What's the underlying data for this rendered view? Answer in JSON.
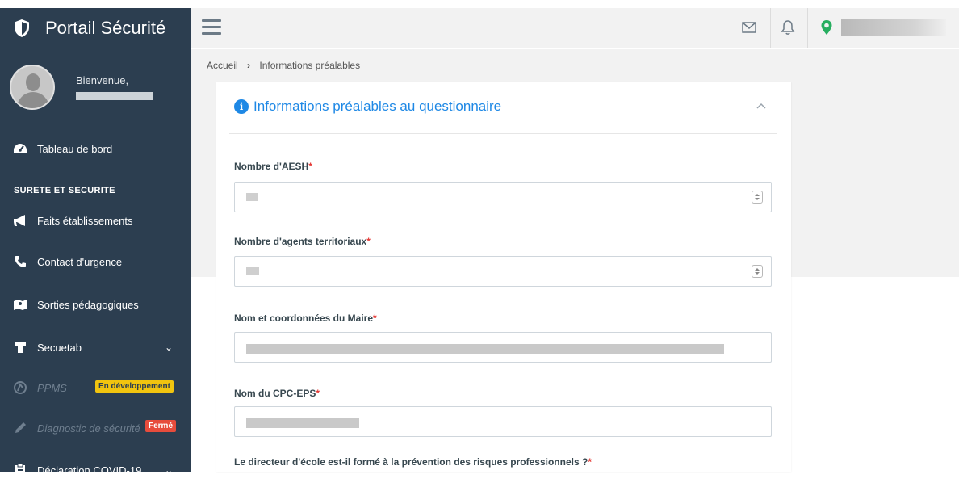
{
  "app": {
    "title": "Portail Sécurité"
  },
  "user": {
    "greeting": "Bienvenue,"
  },
  "sidebar": {
    "dashboard": {
      "label": "Tableau de bord",
      "icon": "tachometer-icon"
    },
    "section_title": "SURETE ET SECURITE",
    "items": [
      {
        "label": "Faits établissements",
        "icon": "megaphone-icon"
      },
      {
        "label": "Contact d'urgence",
        "icon": "phone-icon"
      },
      {
        "label": "Sorties pédagogiques",
        "icon": "map-icon"
      },
      {
        "label": "Secuetab",
        "icon": "shirt-icon",
        "expandable": true
      },
      {
        "label": "PPMS",
        "icon": "pied-piper-icon",
        "disabled": true,
        "badge": "En développement",
        "badge_color": "#f1c40f"
      },
      {
        "label": "Diagnostic de sécurité",
        "icon": "pencil-icon",
        "disabled": true,
        "badge": "Fermé",
        "badge_color": "#e74c3c"
      },
      {
        "label": "Déclaration COVID-19",
        "icon": "clipboard-icon",
        "expandable": true
      }
    ]
  },
  "topbar": {
    "icons": [
      "menu-icon",
      "envelope-icon",
      "bell-icon",
      "map-marker-icon"
    ],
    "accent": "#27ae60"
  },
  "breadcrumb": {
    "home": "Accueil",
    "separator": "›",
    "current": "Informations préalables"
  },
  "card": {
    "title": "Informations préalables au questionnaire",
    "accent": "#1e88e5",
    "fields": [
      {
        "label": "Nombre d'AESH",
        "required": "*",
        "type": "number"
      },
      {
        "label": "Nombre d'agents territoriaux",
        "required": "*",
        "type": "number"
      },
      {
        "label": "Nom et coordonnées du Maire",
        "required": "*",
        "type": "text"
      },
      {
        "label": "Nom du CPC-EPS",
        "required": "*",
        "type": "text"
      },
      {
        "label": "Le directeur d'école est-il formé à la prévention des risques professionnels ?",
        "required": "*",
        "type": "question"
      }
    ]
  }
}
